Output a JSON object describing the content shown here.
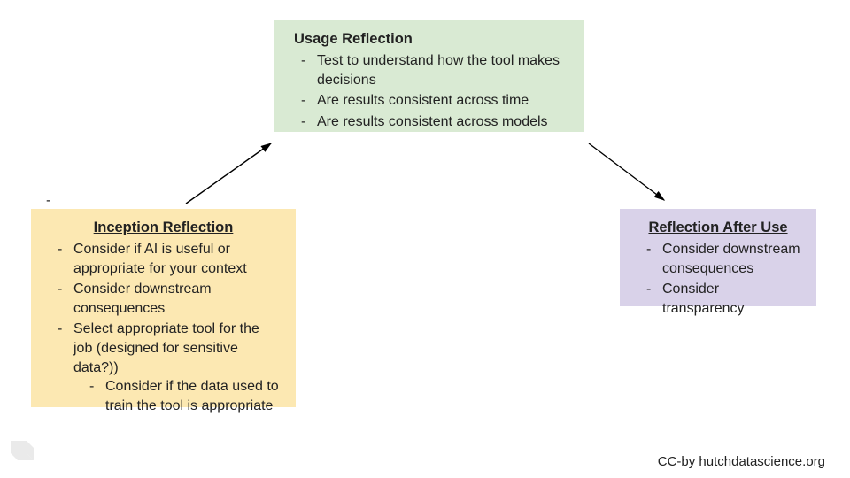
{
  "usage": {
    "title": "Usage Reflection",
    "items": [
      "Test to understand how the tool makes decisions",
      "Are results consistent across time",
      "Are results consistent across models"
    ]
  },
  "inception": {
    "title": "Inception Reflection",
    "items": [
      "Consider if AI is useful or appropriate for your context",
      "Consider downstream consequences",
      "Select appropriate  tool for the job (designed for sensitive data?))"
    ],
    "subitem": "Consider if the data used to train the tool is appropriate"
  },
  "after": {
    "title": "Reflection After Use",
    "items": [
      "Consider downstream consequences",
      "Consider transparency"
    ]
  },
  "stray_dash": "-",
  "attribution": "CC-by  hutchdatascience.org"
}
